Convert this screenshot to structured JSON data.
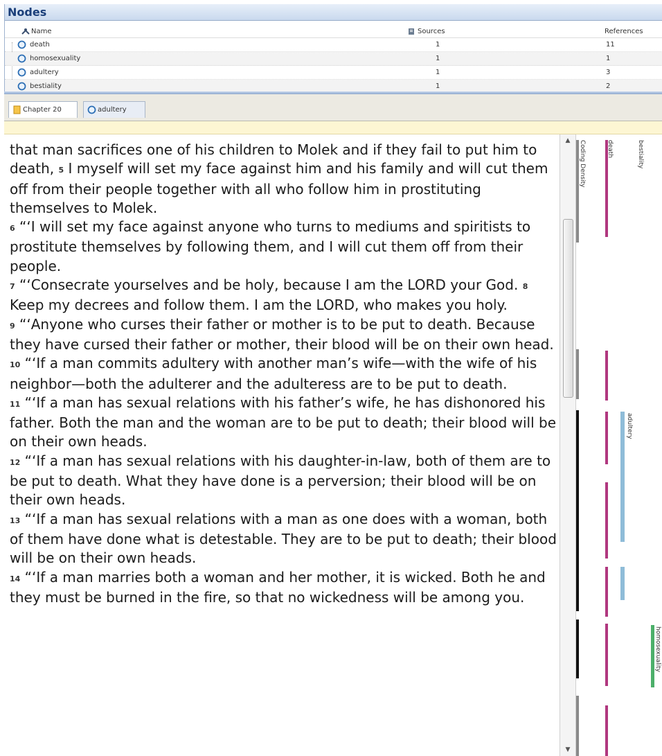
{
  "nodes_panel": {
    "title": "Nodes",
    "columns": {
      "name": "Name",
      "sources": "Sources",
      "references": "References"
    },
    "rows": [
      {
        "name": "death",
        "sources": "1",
        "references": "11"
      },
      {
        "name": "homosexuality",
        "sources": "1",
        "references": "1"
      },
      {
        "name": "adultery",
        "sources": "1",
        "references": "3"
      },
      {
        "name": "bestiality",
        "sources": "1",
        "references": "2"
      }
    ]
  },
  "tabs": [
    {
      "label": "Chapter 20"
    },
    {
      "label": "adultery"
    }
  ],
  "document": {
    "paragraphs": [
      {
        "verse": "",
        "text": "that man sacrifices one of his children to Molek and if they fail to put him to death, "
      },
      {
        "verse": "6",
        "text": "“‘I will set my face against anyone who turns to mediums and spiritists to prostitute themselves by following them, and I will cut them off from their people."
      },
      {
        "verse": "7",
        "text": "“‘Consecrate yourselves and be holy, because I am the LORD your God. "
      },
      {
        "verse": "9",
        "text": "“‘Anyone who curses their father or mother is to be put to death. Because they have cursed their father or mother, their blood will be on their own head."
      },
      {
        "verse": "10",
        "text": "“‘If a man commits adultery with another man’s wife—with the wife of his neighbor—both the adulterer and the adulteress are to be put to death."
      },
      {
        "verse": "11",
        "text": "“‘If a man has sexual relations with his father’s wife, he has dishonored his father. Both the man and the woman are to be put to death; their blood will be on their own heads."
      },
      {
        "verse": "12",
        "text": "“‘If a man has sexual relations with his daughter-in-law, both of them are to be put to death. What they have done is a perversion; their blood will be on their own heads."
      },
      {
        "verse": "13",
        "text": "“‘If a man has sexual relations with a man as one does with a woman, both of them have done what is detestable. They are to be put to death; their blood will be on their own heads."
      },
      {
        "verse": "14",
        "text": "“‘If a man marries both a woman and her mother, it is wicked. Both he and they must be burned in the fire, so that no wickedness will be among you."
      }
    ],
    "p1_verse": "5",
    "p1_cont": "I myself will set my face against him and his family and will cut them off from their people together with all who follow him in prostituting themselves to Molek.",
    "p3_verse": "8",
    "p3_cont": "Keep my decrees and follow them. I am the LORD, who makes you holy."
  },
  "coding_stripes": {
    "labels": [
      "Coding Density",
      "death",
      "bestiality",
      "adultery",
      "homosexuality"
    ],
    "colors": {
      "density": "#8a8a8a",
      "density_dark": "#111111",
      "death": "#b0387f",
      "adultery": "#8fbcd8",
      "homosexuality": "#4caf6a"
    }
  }
}
